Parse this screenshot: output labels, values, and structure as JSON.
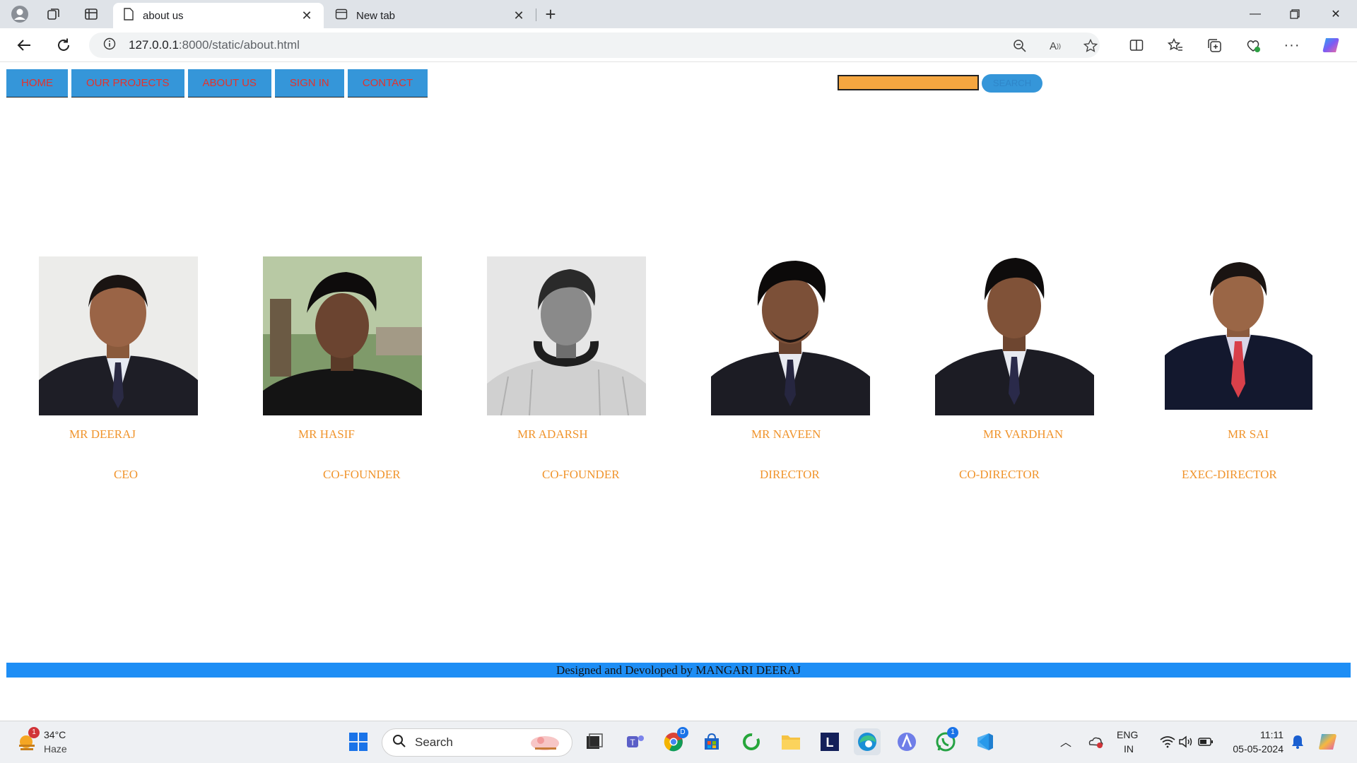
{
  "browser": {
    "tabs": [
      {
        "title": "about us",
        "active": true
      },
      {
        "title": "New tab",
        "active": false
      }
    ],
    "url_host": "127.0.0.1",
    "url_path": ":8000/static/about.html"
  },
  "page": {
    "nav": [
      "HOME",
      "OUR PROJECTS",
      "ABOUT US",
      "SIGN IN",
      "CONTACT"
    ],
    "search": {
      "value": "",
      "button_label": "SEARCH"
    },
    "members": [
      {
        "name": "MR DEERAJ",
        "role": "CEO",
        "photo": "suit-portrait"
      },
      {
        "name": "MR HASIF",
        "role": "CO-FOUNDER",
        "photo": "outdoor-portrait"
      },
      {
        "name": "MR ADARSH",
        "role": "CO-FOUNDER",
        "photo": "grayscale-portrait"
      },
      {
        "name": "MR NAVEEN",
        "role": "DIRECTOR",
        "photo": "suit-portrait"
      },
      {
        "name": "MR VARDHAN",
        "role": "CO-DIRECTOR",
        "photo": "suit-portrait"
      },
      {
        "name": "MR SAI",
        "role": "EXEC-DIRECTOR",
        "photo": "suit-portrait-red-tie"
      }
    ],
    "footer": "Designed and Devoloped by MANGARI DEERAJ"
  },
  "taskbar": {
    "weather": {
      "temp": "34°C",
      "condition": "Haze",
      "badge": "1"
    },
    "search_placeholder": "Search",
    "tray": {
      "lang": "ENG",
      "region": "IN",
      "time": "11:11",
      "date": "05-05-2024"
    },
    "chrome_badge": "D",
    "whatsapp_badge": "1",
    "apps": [
      "file-explorer",
      "teams",
      "chrome",
      "store",
      "cycle-app",
      "folder",
      "l-app",
      "edge",
      "arc-app",
      "whatsapp",
      "vscode"
    ]
  },
  "colors": {
    "nav_bg": "#3596d9",
    "nav_text": "#e5322b",
    "accent_text": "#f0942c",
    "search_field": "#f4a640",
    "footer_bg": "#1e8ef5"
  }
}
